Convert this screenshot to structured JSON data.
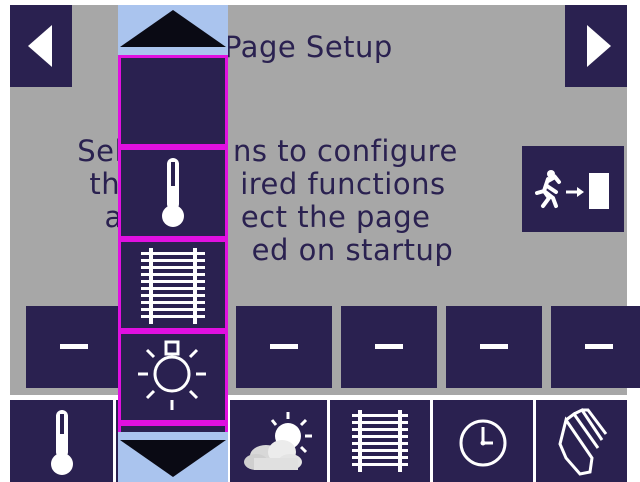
{
  "header": {
    "title": "Page Setup",
    "prev_icon": "left-arrow-icon",
    "next_icon": "right-arrow-icon"
  },
  "message": {
    "line1": "Sel",
    "line1_end": "ns  to  configure",
    "line2": "th",
    "line2_end": "ired  functions",
    "line3": "a",
    "line3_end": "ect  the  page",
    "line4_end": "ed  on  startup"
  },
  "exit_button": {
    "icon": "exit-door-icon"
  },
  "slots": [
    {
      "label": "–"
    },
    {
      "label": "–"
    },
    {
      "label": "–"
    },
    {
      "label": "–"
    },
    {
      "label": "–"
    },
    {
      "label": "–"
    }
  ],
  "bottom_bar": [
    {
      "icon": "thermometer-icon"
    },
    {
      "icon": "empty"
    },
    {
      "icon": "weather-icon"
    },
    {
      "icon": "blinds-icon"
    },
    {
      "icon": "timer-icon"
    },
    {
      "icon": "hand-icon"
    }
  ],
  "picker": {
    "up_icon": "up-triangle-icon",
    "down_icon": "down-triangle-icon",
    "items": [
      {
        "icon": "empty"
      },
      {
        "icon": "thermometer-icon"
      },
      {
        "icon": "blinds-icon"
      },
      {
        "icon": "light-bulb-icon"
      }
    ]
  },
  "colors": {
    "panel": "#2a2150",
    "background": "#a7a7a7",
    "highlight": "#e010e0",
    "picker_arrow": "#aac4ee"
  }
}
